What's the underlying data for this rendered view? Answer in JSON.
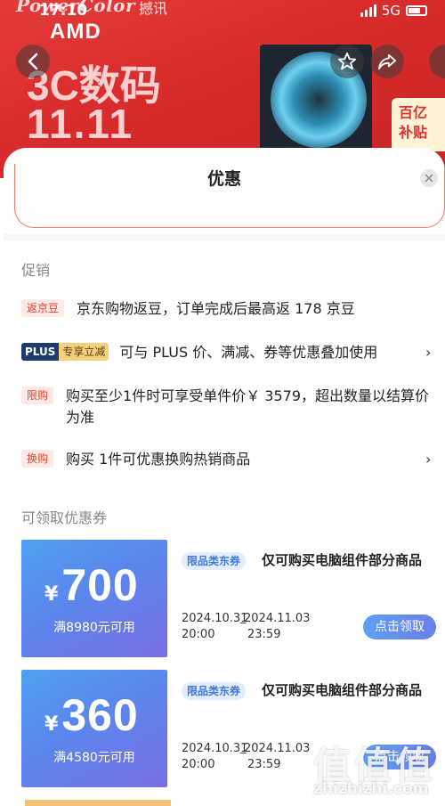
{
  "status_bar": {
    "time": "17:10",
    "network": "5G"
  },
  "banner": {
    "brand": "PowerColor",
    "brand_suffix": "撼讯",
    "amd": "AMD",
    "headline_1": "3C数码",
    "headline_2": "11.11",
    "promo_tag": "百亿\n补贴"
  },
  "sheet": {
    "title": "优惠",
    "close_icon": "close-icon"
  },
  "promotions": {
    "section_title": "促销",
    "items": [
      {
        "tag": "返京豆",
        "text": "京东购物返豆，订单完成后最高返 178 京豆",
        "chevron": false
      },
      {
        "tag_plus": "PLUS",
        "tag_exclusive": "专享立减",
        "text": "可与 PLUS 价、满减、券等优惠叠加使用",
        "chevron": true
      },
      {
        "tag": "限购",
        "text": "购买至少1件时可享受单件价￥ 3579，超出数量以结算价为准",
        "chevron": false
      },
      {
        "tag": "换购",
        "text": "购买 1件可优惠换购热销商品",
        "chevron": true
      }
    ]
  },
  "coupons": {
    "section_title": "可领取优惠券",
    "currency": "¥",
    "items": [
      {
        "amount": "700",
        "condition": "满8980元可用",
        "type_tag": "限品类东券",
        "description": "仅可购买电脑组件部分商品",
        "start_date": "2024.10.31",
        "start_time": "20:00",
        "dash": "_",
        "end_date": "2024.11.03",
        "end_time": "23:59",
        "button": "点击领取"
      },
      {
        "amount": "360",
        "condition": "满4580元可用",
        "type_tag": "限品类东券",
        "description": "仅可购买电脑组件部分商品",
        "start_date": "2024.10.31",
        "start_time": "20:00",
        "dash": "_",
        "end_date": "2024.11.03",
        "end_time": "23:59",
        "button": "点击领取"
      }
    ]
  },
  "watermark": {
    "chars": "值值值",
    "url": "zhizhizhi.com"
  }
}
